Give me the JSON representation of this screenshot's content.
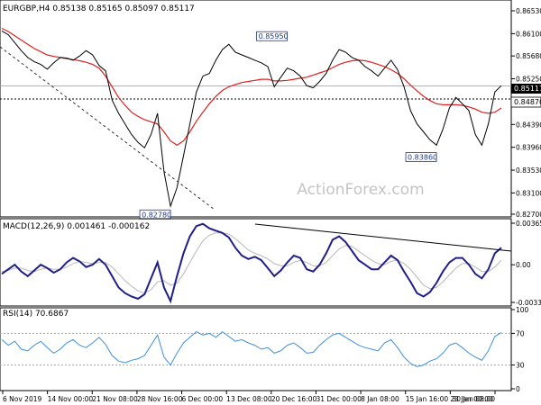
{
  "chart_data": [
    {
      "type": "line",
      "title": "EURGBP,H4  0.85138 0.85165 0.85097 0.85117",
      "series": [
        {
          "label": "price",
          "color": "#000000",
          "values": [
            0.8615,
            0.8608,
            0.8593,
            0.8578,
            0.8565,
            0.8557,
            0.8552,
            0.8543,
            0.8555,
            0.8565,
            0.8564,
            0.856,
            0.8568,
            0.8578,
            0.857,
            0.855,
            0.854,
            0.8485,
            0.846,
            0.844,
            0.842,
            0.8405,
            0.8395,
            0.842,
            0.846,
            0.835,
            0.8285,
            0.832,
            0.838,
            0.844,
            0.85,
            0.853,
            0.8535,
            0.856,
            0.858,
            0.859,
            0.8575,
            0.857,
            0.8565,
            0.856,
            0.8555,
            0.8548,
            0.851,
            0.8528,
            0.8545,
            0.854,
            0.853,
            0.8512,
            0.8508,
            0.852,
            0.8535,
            0.856,
            0.858,
            0.8575,
            0.8565,
            0.856,
            0.8548,
            0.854,
            0.853,
            0.8545,
            0.856,
            0.8542,
            0.851,
            0.8465,
            0.844,
            0.8425,
            0.841,
            0.84,
            0.843,
            0.847,
            0.849,
            0.8478,
            0.8465,
            0.842,
            0.84,
            0.844,
            0.85,
            0.8512
          ]
        },
        {
          "label": "ma",
          "color": "#e02020",
          "values": [
            0.862,
            0.8614,
            0.8606,
            0.8598,
            0.859,
            0.8582,
            0.8576,
            0.857,
            0.8567,
            0.8565,
            0.8563,
            0.8561,
            0.8559,
            0.8556,
            0.8552,
            0.8545,
            0.853,
            0.851,
            0.849,
            0.8475,
            0.8462,
            0.8454,
            0.8448,
            0.8444,
            0.844,
            0.8425,
            0.8408,
            0.84,
            0.8408,
            0.8425,
            0.8445,
            0.8462,
            0.8478,
            0.8492,
            0.8503,
            0.851,
            0.8514,
            0.8518,
            0.852,
            0.8522,
            0.8524,
            0.8524,
            0.8521,
            0.8521,
            0.8522,
            0.8524,
            0.8526,
            0.8528,
            0.8532,
            0.8536,
            0.854,
            0.8546,
            0.8552,
            0.8556,
            0.8559,
            0.856,
            0.8559,
            0.8556,
            0.8552,
            0.8548,
            0.8542,
            0.8535,
            0.8525,
            0.8513,
            0.8502,
            0.8492,
            0.8484,
            0.8478,
            0.8476,
            0.8476,
            0.8476,
            0.8475,
            0.8472,
            0.8468,
            0.8462,
            0.846,
            0.8462,
            0.847
          ]
        }
      ],
      "y_ticks": [
        "0.86530",
        "0.86100",
        "0.85680",
        "0.85250",
        "0.84820",
        "0.84390",
        "0.83960",
        "0.83530",
        "0.83100",
        "0.82700"
      ],
      "ylim": [
        0.827,
        0.8653
      ],
      "current_price_label": "0.85117",
      "reference_level_label": "0.84870",
      "annotations": [
        {
          "text": "0.85950",
          "x": 44,
          "y": 0.8595
        },
        {
          "text": "0.83860",
          "x": 67,
          "y": 0.8386
        },
        {
          "text": "0.82780",
          "x": 26,
          "y": 0.8278
        }
      ],
      "x_labels": [
        "6 Nov 2019",
        "14 Nov 00:00",
        "21 Nov 08:00",
        "28 Nov 16:00",
        "6 Dec 00:00",
        "13 Dec 08:00",
        "20 Dec 16:00",
        "31 Dec 00:00",
        "8 Jan 08:00",
        "15 Jan 16:00",
        "23 Jan 00:00",
        "30 Jan 08:00"
      ],
      "watermark": "ActionForex.com"
    },
    {
      "type": "line",
      "title": "MACD(12,26,9) 0.001461 -0.000162",
      "series": [
        {
          "label": "macd",
          "color": "#1f1f8a",
          "values": [
            -0.0008,
            -0.0004,
            0.0,
            -0.0006,
            -0.001,
            -0.0005,
            0.0,
            -0.0003,
            -0.0007,
            -0.0004,
            0.0002,
            0.0006,
            0.0003,
            -0.0002,
            0.0,
            0.0005,
            0.0,
            -0.001,
            -0.002,
            -0.0025,
            -0.0028,
            -0.003,
            -0.0026,
            -0.0012,
            0.0002,
            -0.002,
            -0.0032,
            -0.001,
            0.001,
            0.0025,
            0.0034,
            0.0036,
            0.0032,
            0.003,
            0.0028,
            0.0024,
            0.0015,
            0.0008,
            0.0005,
            0.0007,
            0.0004,
            -0.0003,
            -0.001,
            -0.0005,
            0.0002,
            0.0008,
            0.0006,
            -0.0004,
            -0.0006,
            0.0,
            0.001,
            0.0022,
            0.0025,
            0.002,
            0.0012,
            0.0004,
            0.0,
            -0.0004,
            -0.0004,
            0.0002,
            0.0008,
            0.0004,
            -0.0006,
            -0.0015,
            -0.0025,
            -0.0028,
            -0.0024,
            -0.0016,
            -0.0006,
            0.0002,
            0.0006,
            0.0006,
            0.0,
            -0.0008,
            -0.0012,
            -0.0004,
            0.001,
            0.0015
          ]
        },
        {
          "label": "signal",
          "color": "#b8b8b8",
          "values": [
            -0.0006,
            -0.0005,
            -0.0003,
            -0.0003,
            -0.0005,
            -0.0006,
            -0.0004,
            -0.0003,
            -0.0004,
            -0.0004,
            -0.0002,
            0.0001,
            0.0003,
            0.0002,
            0.0001,
            0.0002,
            0.0002,
            -0.0002,
            -0.0008,
            -0.0014,
            -0.0019,
            -0.0023,
            -0.0025,
            -0.0022,
            -0.0015,
            -0.0014,
            -0.0018,
            -0.0016,
            -0.0008,
            0.0002,
            0.0012,
            0.0021,
            0.0026,
            0.0028,
            0.0028,
            0.0027,
            0.0023,
            0.0018,
            0.0013,
            0.001,
            0.0008,
            0.0005,
            0.0001,
            -0.0001,
            -0.0001,
            0.0002,
            0.0004,
            0.0002,
            -0.0001,
            -0.0001,
            0.0002,
            0.0008,
            0.0014,
            0.0017,
            0.0016,
            0.0012,
            0.0008,
            0.0004,
            0.0001,
            0.0,
            0.0003,
            0.0004,
            0.0001,
            -0.0004,
            -0.0011,
            -0.0018,
            -0.0021,
            -0.002,
            -0.0015,
            -0.0009,
            -0.0003,
            0.0001,
            0.0001,
            -0.0002,
            -0.0006,
            -0.0006,
            -0.0002,
            0.0004
          ]
        }
      ],
      "y_ticks": [
        "0.003654",
        "0.00",
        "-0.003314"
      ],
      "ylim": [
        -0.003314,
        0.003654
      ]
    },
    {
      "type": "line",
      "title": "RSI(14) 70.6867",
      "series": [
        {
          "label": "rsi",
          "color": "#3d8fe0",
          "values": [
            62,
            55,
            60,
            50,
            48,
            55,
            60,
            52,
            45,
            50,
            58,
            62,
            55,
            52,
            58,
            65,
            56,
            42,
            35,
            33,
            36,
            38,
            42,
            55,
            68,
            40,
            30,
            45,
            58,
            65,
            72,
            68,
            70,
            65,
            72,
            66,
            60,
            62,
            58,
            55,
            50,
            52,
            45,
            48,
            55,
            58,
            52,
            45,
            46,
            55,
            62,
            68,
            70,
            65,
            60,
            55,
            52,
            50,
            48,
            58,
            62,
            52,
            40,
            32,
            28,
            30,
            35,
            38,
            45,
            55,
            58,
            52,
            45,
            40,
            36,
            48,
            66,
            71
          ]
        }
      ],
      "y_ticks": [
        "100",
        "70",
        "30",
        "0"
      ],
      "ylim": [
        0,
        100
      ],
      "levels": [
        70,
        30
      ]
    }
  ]
}
